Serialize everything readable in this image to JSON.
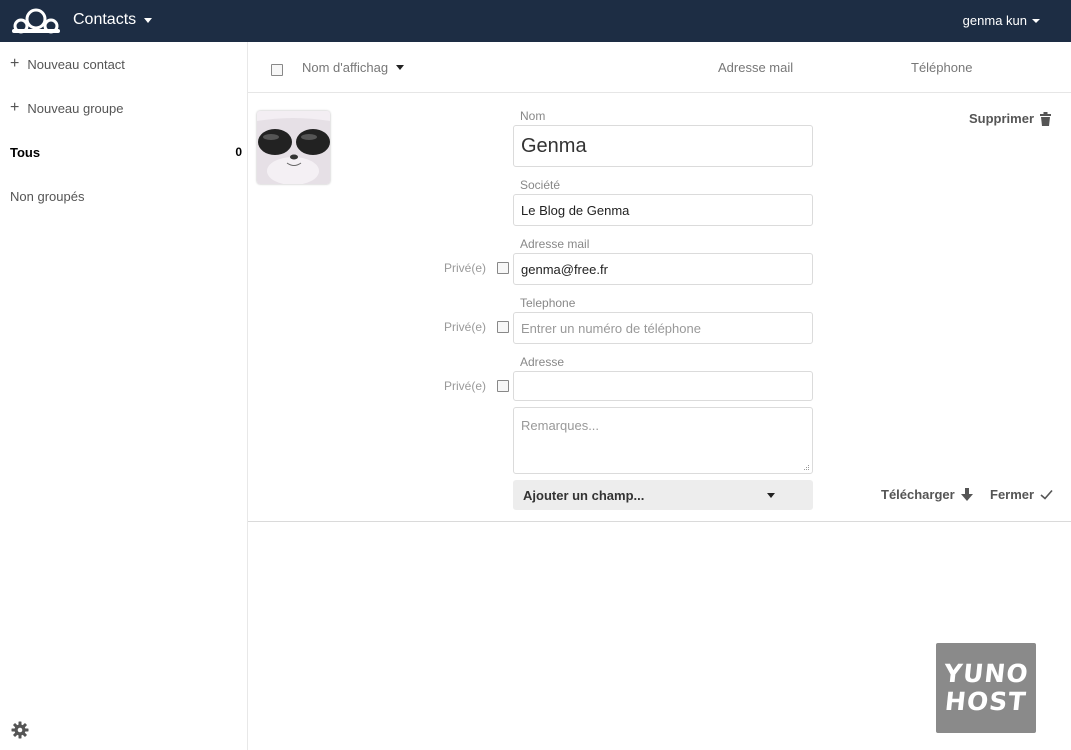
{
  "header": {
    "app_title": "Contacts",
    "user": "genma kun"
  },
  "sidebar": {
    "new_contact": "Nouveau contact",
    "new_group": "Nouveau groupe",
    "all": {
      "label": "Tous",
      "count": "0"
    },
    "ungrouped": "Non groupés",
    "plus_symbol": "+"
  },
  "list_header": {
    "display_name": "Nom d'affichag",
    "email": "Adresse mail",
    "phone": "Téléphone"
  },
  "contact": {
    "name_label": "Nom",
    "name_value": "Genma",
    "company_label": "Société",
    "company_value": "Le Blog de Genma",
    "email_label": "Adresse mail",
    "email_value": "genma@free.fr",
    "phone_label": "Telephone",
    "phone_placeholder": "Entrer un numéro de téléphone",
    "address_label": "Adresse",
    "address_value": "",
    "notes_placeholder": "Remarques...",
    "private_label": "Privé(e)",
    "add_field": "Ajouter un champ...",
    "delete": "Supprimer",
    "download": "Télécharger",
    "close": "Fermer"
  },
  "badge": {
    "line1": "YUNO",
    "line2": "HOST"
  },
  "colors": {
    "header_bg": "#1d2d44",
    "badge_bg": "#8a8a8a"
  },
  "icons": [
    "cloud-logo-icon",
    "caret-down-icon",
    "plus-icon",
    "gear-icon",
    "trash-icon",
    "download-arrow-icon",
    "checkmark-icon"
  ]
}
